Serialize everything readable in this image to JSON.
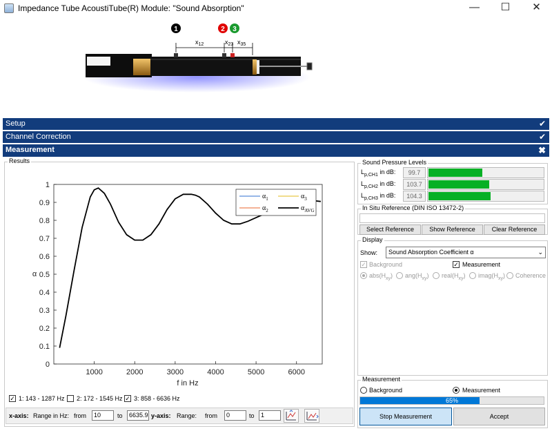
{
  "window": {
    "title": "Impedance Tube AcoustiTube(R) Module: \"Sound Absorption\"",
    "controls": {
      "minimize": "—",
      "maximize": "☐",
      "close": "✕"
    }
  },
  "tube_diagram": {
    "markers": [
      "1",
      "2",
      "3"
    ],
    "marker_colors": [
      "#000000",
      "#e00000",
      "#1a9a2e"
    ],
    "dims": {
      "x12": "x",
      "x12_sub": "12",
      "x23": "x",
      "x23_sub": "23",
      "x35": "x",
      "x35_sub": "35"
    }
  },
  "panels": {
    "setup": "Setup",
    "channel_correction": "Channel Correction",
    "measurement": "Measurement"
  },
  "results": {
    "title": "Results",
    "chart_data": {
      "type": "line",
      "xlabel": "f in Hz",
      "ylabel": "α",
      "xlim": [
        0,
        6636
      ],
      "ylim": [
        0,
        1
      ],
      "xticks": [
        1000,
        2000,
        3000,
        4000,
        5000,
        6000
      ],
      "yticks": [
        0,
        0.1,
        0.2,
        0.3,
        0.4,
        0.5,
        0.6,
        0.7,
        0.8,
        0.9,
        1
      ],
      "legend": {
        "placement": "top-right",
        "entries": [
          {
            "symbol": "α",
            "sub": "1",
            "color": "#2d6fd1"
          },
          {
            "symbol": "α",
            "sub": "2",
            "color": "#e8642c"
          },
          {
            "symbol": "α",
            "sub": "3",
            "color": "#e0b81a"
          },
          {
            "symbol": "α",
            "sub": "AVG",
            "color": "#000000"
          }
        ]
      },
      "series": [
        {
          "name": "αAVG",
          "x": [
            143,
            300,
            500,
            700,
            900,
            1000,
            1100,
            1250,
            1400,
            1600,
            1800,
            2000,
            2200,
            2400,
            2600,
            2800,
            3000,
            3200,
            3400,
            3500,
            3600,
            3800,
            4000,
            4200,
            4400,
            4600,
            4800,
            5000,
            5200,
            5400,
            5600,
            5800,
            6000,
            6200,
            6400,
            6600
          ],
          "y": [
            0.09,
            0.27,
            0.52,
            0.76,
            0.93,
            0.97,
            0.98,
            0.95,
            0.89,
            0.79,
            0.72,
            0.69,
            0.69,
            0.72,
            0.78,
            0.86,
            0.92,
            0.945,
            0.945,
            0.94,
            0.93,
            0.89,
            0.84,
            0.8,
            0.78,
            0.78,
            0.795,
            0.815,
            0.835,
            0.855,
            0.87,
            0.885,
            0.895,
            0.905,
            0.91,
            0.905
          ]
        }
      ]
    },
    "checks": [
      {
        "label": "1: 143 - 1287 Hz",
        "checked": true
      },
      {
        "label": "2: 172 - 1545 Hz",
        "checked": false
      },
      {
        "label": "3: 858 - 6636 Hz",
        "checked": true
      }
    ],
    "axis_controls": {
      "x_label": "x-axis:",
      "x_range_label": "Range in Hz:",
      "from": "from",
      "to": "to",
      "x_from": "10",
      "x_to": "6635.9",
      "y_label": "y-axis:",
      "y_range_label": "Range:",
      "y_from": "0",
      "y_to": "1"
    }
  },
  "spl": {
    "title": "Sound Pressure Levels",
    "rows": [
      {
        "prefix": "L",
        "sub": "p,CH1",
        "suffix": " in dB:",
        "value": "99.7",
        "fill": 0.47
      },
      {
        "prefix": "L",
        "sub": "p,CH2",
        "suffix": " in dB:",
        "value": "103.7",
        "fill": 0.53
      },
      {
        "prefix": "L",
        "sub": "p,CH3",
        "suffix": " in dB:",
        "value": "104.3",
        "fill": 0.54
      }
    ]
  },
  "insitu": {
    "title": "In Situ Reference (DIN ISO 13472-2)",
    "buttons": [
      "Select Reference",
      "Show Reference",
      "Clear Reference"
    ]
  },
  "display": {
    "title": "Display",
    "show_label": "Show:",
    "show_value": "Sound Absorption Coefficient α",
    "background_label": "Background",
    "measurement_label": "Measurement",
    "modes": [
      {
        "text": "abs(H",
        "sub": "xy",
        "end": ")"
      },
      {
        "text": "ang(H",
        "sub": "xy",
        "end": ")"
      },
      {
        "text": "real(H",
        "sub": "xy",
        "end": ")"
      },
      {
        "text": "imag(H",
        "sub": "xy",
        "end": ")"
      },
      {
        "text": "Coherence",
        "sub": "",
        "end": ""
      }
    ]
  },
  "measure": {
    "title": "Measurement",
    "radio_background": "Background",
    "radio_measurement": "Measurement",
    "progress_text": "65%",
    "progress": 0.65,
    "stop_button": "Stop Measurement",
    "accept_button": "Accept"
  }
}
